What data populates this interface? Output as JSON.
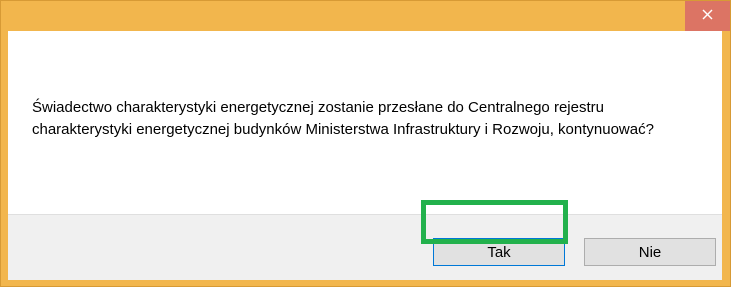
{
  "dialog": {
    "title": "",
    "close_icon": "close-icon",
    "message": "Świadectwo charakterystyki energetycznej zostanie przesłane do Centralnego rejestru charakterystyki energetycznej budynków Ministerstwa Infrastruktury i Rozwoju, kontynuować?",
    "buttons": {
      "yes_label": "Tak",
      "no_label": "Nie"
    }
  },
  "colors": {
    "frame": "#f2b64d",
    "close_button": "#dc7464",
    "highlight": "#22b14c"
  }
}
